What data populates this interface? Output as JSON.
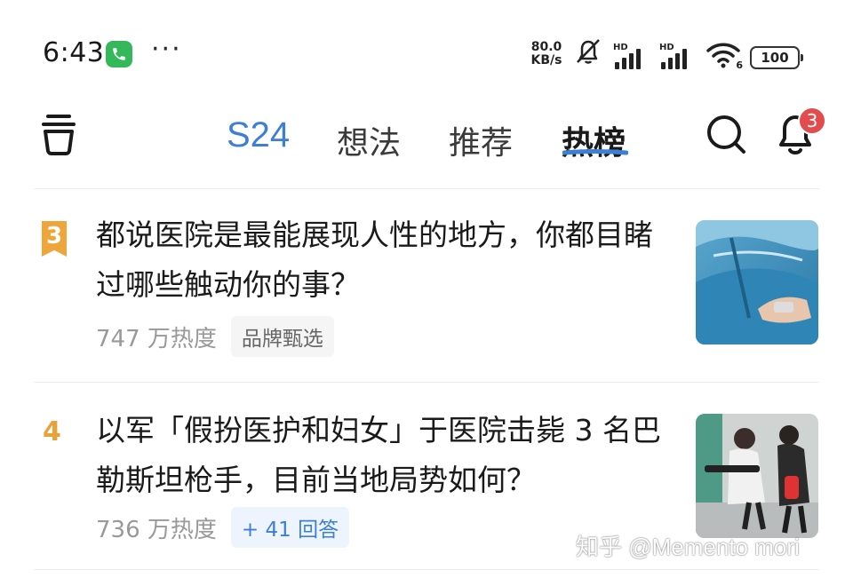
{
  "status_bar": {
    "time": "6:43",
    "more_dots": "···",
    "net_speed_value": "80.0",
    "net_speed_unit": "KB/s",
    "signal_1_label": "HD",
    "signal_2_label": "HD",
    "wifi_label": "6",
    "battery": "100"
  },
  "nav": {
    "tabs": [
      {
        "label": "S24"
      },
      {
        "label": "想法"
      },
      {
        "label": "推荐"
      },
      {
        "label": "热榜"
      }
    ],
    "active_tab": "热榜",
    "notification_count": "3",
    "accent_color": "#3d7fd6"
  },
  "hot_list": [
    {
      "rank": "3",
      "title": "都说医院是最能展现人性的地方，你都目睹过哪些触动你的事？",
      "heat": "747 万热度",
      "tag": "品牌甄选"
    },
    {
      "rank": "4",
      "title": "以军「假扮医护和妇女」于医院击毙 3 名巴勒斯坦枪手，目前当地局势如何？",
      "heat": "736 万热度",
      "tag": "+ 41 回答"
    }
  ],
  "watermark": "知乎 @Memento mori"
}
